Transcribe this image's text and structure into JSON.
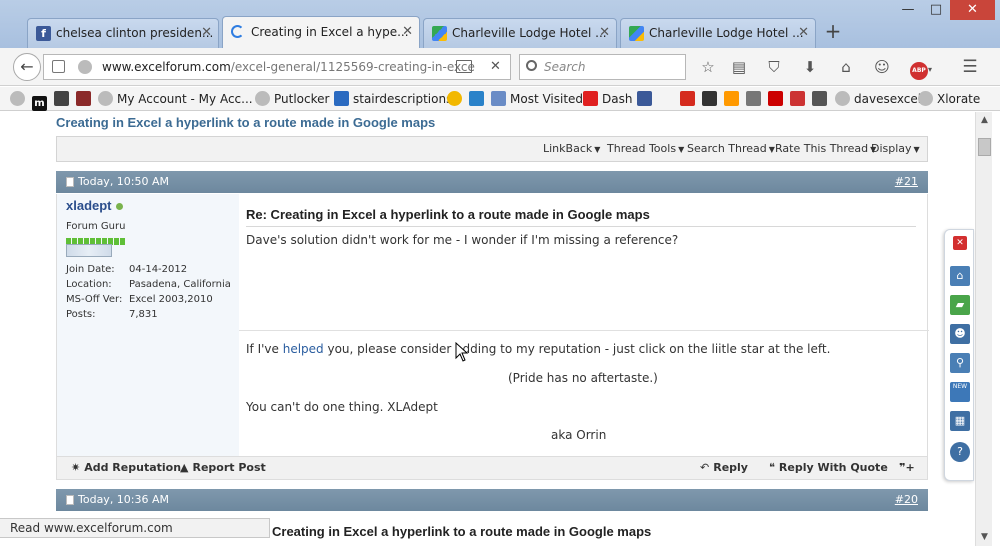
{
  "tabs": [
    {
      "label": "chelsea clinton presiden...",
      "icon": "facebook-icon",
      "color": "#3b5998"
    },
    {
      "label": "Creating in Excel a hype...",
      "icon": "loading-icon",
      "color": "#2f7de1"
    },
    {
      "label": "Charleville Lodge Hotel ...",
      "icon": "google-maps-icon",
      "color": "#34a853"
    },
    {
      "label": "Charleville Lodge Hotel ...",
      "icon": "google-maps-icon",
      "color": "#34a853"
    }
  ],
  "window": {
    "minimize": "—",
    "maximize": "□",
    "close": "✕",
    "new_tab": "+"
  },
  "nav": {
    "url_host": "www.excelforum.com",
    "url_path": "/excel-general/1125569-creating-in-exce",
    "search_placeholder": "Search",
    "clear": "✕"
  },
  "bookmarks": [
    {
      "label": "",
      "icon": "globe-icon",
      "color": "#aaa"
    },
    {
      "label": "",
      "icon": "m-icon",
      "color": "#222"
    },
    {
      "label": "",
      "icon": "book-icon",
      "color": "#444"
    },
    {
      "label": "",
      "icon": "bookmark-icon",
      "color": "#8b2a2a"
    },
    {
      "label": "My Account - My Acc...",
      "icon": "globe-icon",
      "color": "#aaa"
    },
    {
      "label": "Putlocker",
      "icon": "globe-icon",
      "color": "#aaa"
    },
    {
      "label": "stairdescriptions",
      "icon": "x-icon",
      "color": "#2a6ac0"
    },
    {
      "label": "",
      "icon": "star-icon",
      "color": "#f2b800"
    },
    {
      "label": "",
      "icon": "d-icon",
      "color": "#2a82c9"
    },
    {
      "label": "Most Visited",
      "icon": "list-icon",
      "color": "#6a8cc6"
    },
    {
      "label": "Dash",
      "icon": "youtube-icon",
      "color": "#e02020"
    },
    {
      "label": "",
      "icon": "facebook-icon",
      "color": "#3b5998"
    },
    {
      "label": "",
      "icon": "maple-leaf-icon",
      "color": "#d52b1e"
    },
    {
      "label": "",
      "icon": "flag-icon",
      "color": "#333"
    },
    {
      "label": "",
      "icon": "amazon-icon",
      "color": "#f90"
    },
    {
      "label": "",
      "icon": "x-icon",
      "color": "#555"
    },
    {
      "label": "",
      "icon": "cross-icon",
      "color": "#c00"
    },
    {
      "label": "",
      "icon": "gift-icon",
      "color": "#c33"
    },
    {
      "label": "",
      "icon": "db-icon",
      "color": "#555"
    },
    {
      "label": "davesexcel",
      "icon": "globe-icon",
      "color": "#aaa"
    },
    {
      "label": "Xlorate",
      "icon": "globe-icon",
      "color": "#aaa"
    }
  ],
  "thread": {
    "title": "Creating in Excel a hyperlink to a route made in Google maps",
    "tools": [
      "LinkBack",
      "Thread Tools",
      "Search Thread",
      "Rate This Thread",
      "Display"
    ]
  },
  "post": {
    "date": "Today, 10:50 AM",
    "number": "#21",
    "username": "xladept",
    "usertitle": "Forum Guru",
    "join_label": "Join Date:",
    "join_value": "04-14-2012",
    "location_label": "Location:",
    "location_value": "Pasadena, California",
    "msoff_label": "MS-Off Ver:",
    "msoff_value": "Excel 2003,2010",
    "posts_label": "Posts:",
    "posts_value": "7,831",
    "title": "Re: Creating in Excel a hyperlink to a route made in Google maps",
    "message": "Dave's solution didn't work for me - I wonder if I'm missing a reference?",
    "sig_pre": "If I've ",
    "sig_link": "helped",
    "sig_post": " you, please consider adding to my reputation - just click on the liitle star at the left.",
    "sig_pride": "(Pride has no aftertaste.)",
    "sig_cant": "You can't do one thing. XLAdept",
    "sig_aka": "aka Orrin",
    "actions": {
      "add_rep": "Add Reputation",
      "report": "Report Post",
      "reply": "Reply",
      "reply_quote": "Reply With Quote"
    }
  },
  "post2": {
    "date": "Today, 10:36 AM",
    "number": "#20",
    "title": "Creating in Excel a hyperlink to a route made in Google maps"
  },
  "status": "Read www.excelforum.com"
}
